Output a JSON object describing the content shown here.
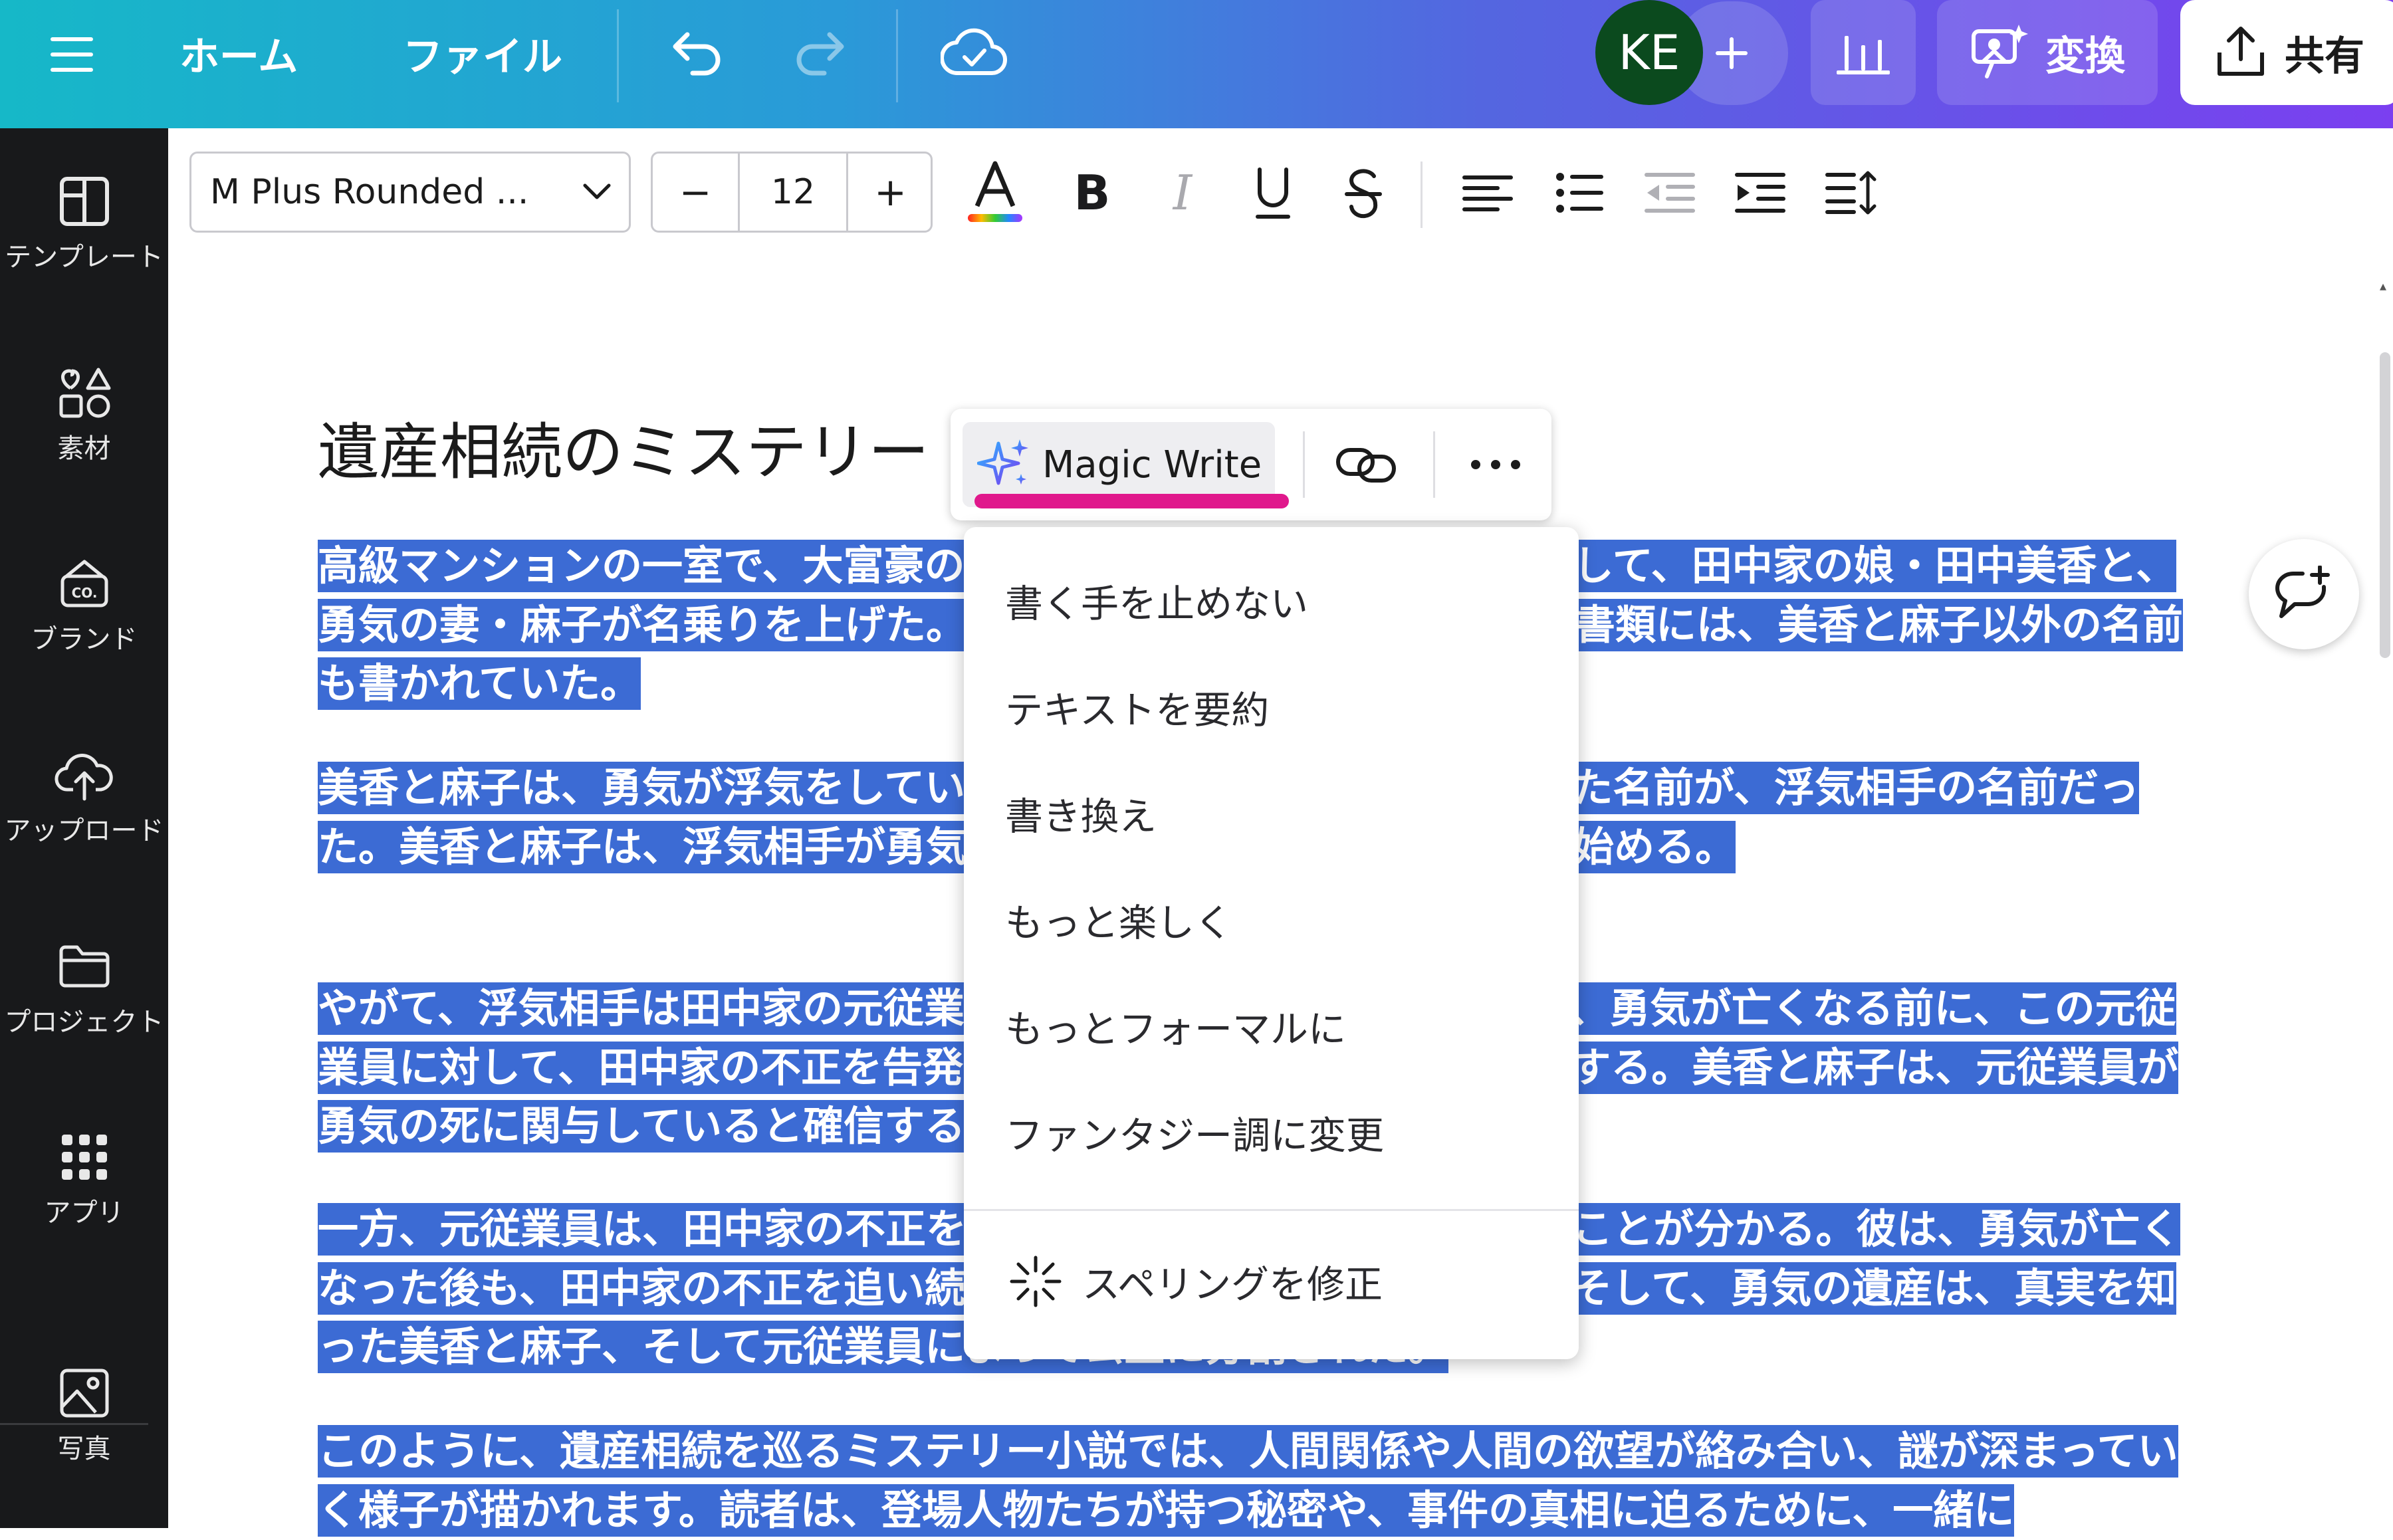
{
  "topbar": {
    "home": "ホーム",
    "file": "ファイル",
    "avatar": "KE",
    "convert": "変換",
    "share": "共有"
  },
  "sidebar": {
    "items": [
      {
        "label": "テンプレート",
        "icon": "template-icon"
      },
      {
        "label": "素材",
        "icon": "elements-icon"
      },
      {
        "label": "ブランド",
        "icon": "brand-icon"
      },
      {
        "label": "アップロード",
        "icon": "upload-icon"
      },
      {
        "label": "プロジェクト",
        "icon": "folder-icon"
      },
      {
        "label": "アプリ",
        "icon": "apps-icon"
      },
      {
        "label": "写真",
        "icon": "photo-icon"
      }
    ],
    "brand_icon_text": "CO."
  },
  "format_toolbar": {
    "font_name": "M Plus Rounded ...",
    "font_size": "12",
    "decrease": "−",
    "increase": "+"
  },
  "document": {
    "title": "遺産相続のミステリー",
    "paragraphs": [
      "高級マンションの一室で、大富豪の田中勇気が亡くなった。相続人として、田中家の娘・田中美香と、勇気の妻・麻子が名乗りを上げた。しかし、勇気が残した遺産分割の書類には、美香と麻子以外の名前も書かれていた。",
      "美香と麻子は、勇気が浮気をしていたことを知る。書類に書かれていた名前が、浮気相手の名前だった。美香と麻子は、浮気相手が勇気の死に関与していると疑い、調べ始める。",
      "やがて、浮気相手は田中家の元従業員であることが判明する。そして、勇気が亡くなる前に、この元従業員に対して、田中家の不正を告発するよう依頼していたことが判明する。美香と麻子は、元従業員が勇気の死に関与していると確信する。",
      "一方、元従業員は、田中家の不正を暴くために、勇気と協力していたことが分かる。彼は、勇気が亡くなった後も、田中家の不正を追い続け、ついに真相が明らかになる。そして、勇気の遺産は、真実を知った美香と麻子、そして元従業員によって公正に分割された。",
      "このように、遺産相続を巡るミステリー小説では、人間関係や人間の欲望が絡み合い、謎が深まっていく様子が描かれます。読者は、登場人物たちが持つ秘密や、事件の真相に迫るために、一緒に"
    ]
  },
  "text_toolbar": {
    "magic_write": "Magic Write",
    "accent_color": "#e0188c"
  },
  "magic_menu": {
    "items": [
      "書く手を止めない",
      "テキストを要約",
      "書き換え",
      "もっと楽しく",
      "もっとフォーマルに",
      "ファンタジー調に変更"
    ],
    "spelling": "スペリングを修正"
  },
  "colors": {
    "selection": "#3c6bd4",
    "sidebar_bg": "#18191b",
    "avatar_bg": "#0b4a1e"
  }
}
